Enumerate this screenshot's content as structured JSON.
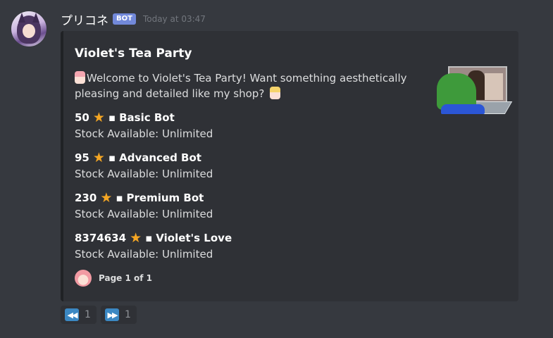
{
  "message": {
    "username": "プリコネ",
    "bot_tag": "BOT",
    "timestamp": "Today at 03:47"
  },
  "embed": {
    "title": "Violet's Tea Party",
    "description": "Welcome to Violet's Tea Party! Want something aesthetically pleasing and detailed like my shop?",
    "fields": [
      {
        "price": "50",
        "name": "Basic Bot",
        "value": "Stock Available: Unlimited"
      },
      {
        "price": "95",
        "name": "Advanced Bot",
        "value": "Stock Available: Unlimited"
      },
      {
        "price": "230",
        "name": "Premium Bot",
        "value": "Stock Available: Unlimited"
      },
      {
        "price": "8374634",
        "name": "Violet's Love",
        "value": "Stock Available: Unlimited"
      }
    ],
    "footer": "Page 1 of 1"
  },
  "reactions": [
    {
      "icon": "rewind-icon",
      "symbol": "◀◀",
      "count": "1"
    },
    {
      "icon": "fast-forward-icon",
      "symbol": "▶▶",
      "count": "1"
    }
  ],
  "colors": {
    "background": "#36393f",
    "embed": "#2f3136",
    "bot_tag": "#7289da",
    "star": "#f5a623",
    "reaction_icon": "#3b88c3"
  }
}
